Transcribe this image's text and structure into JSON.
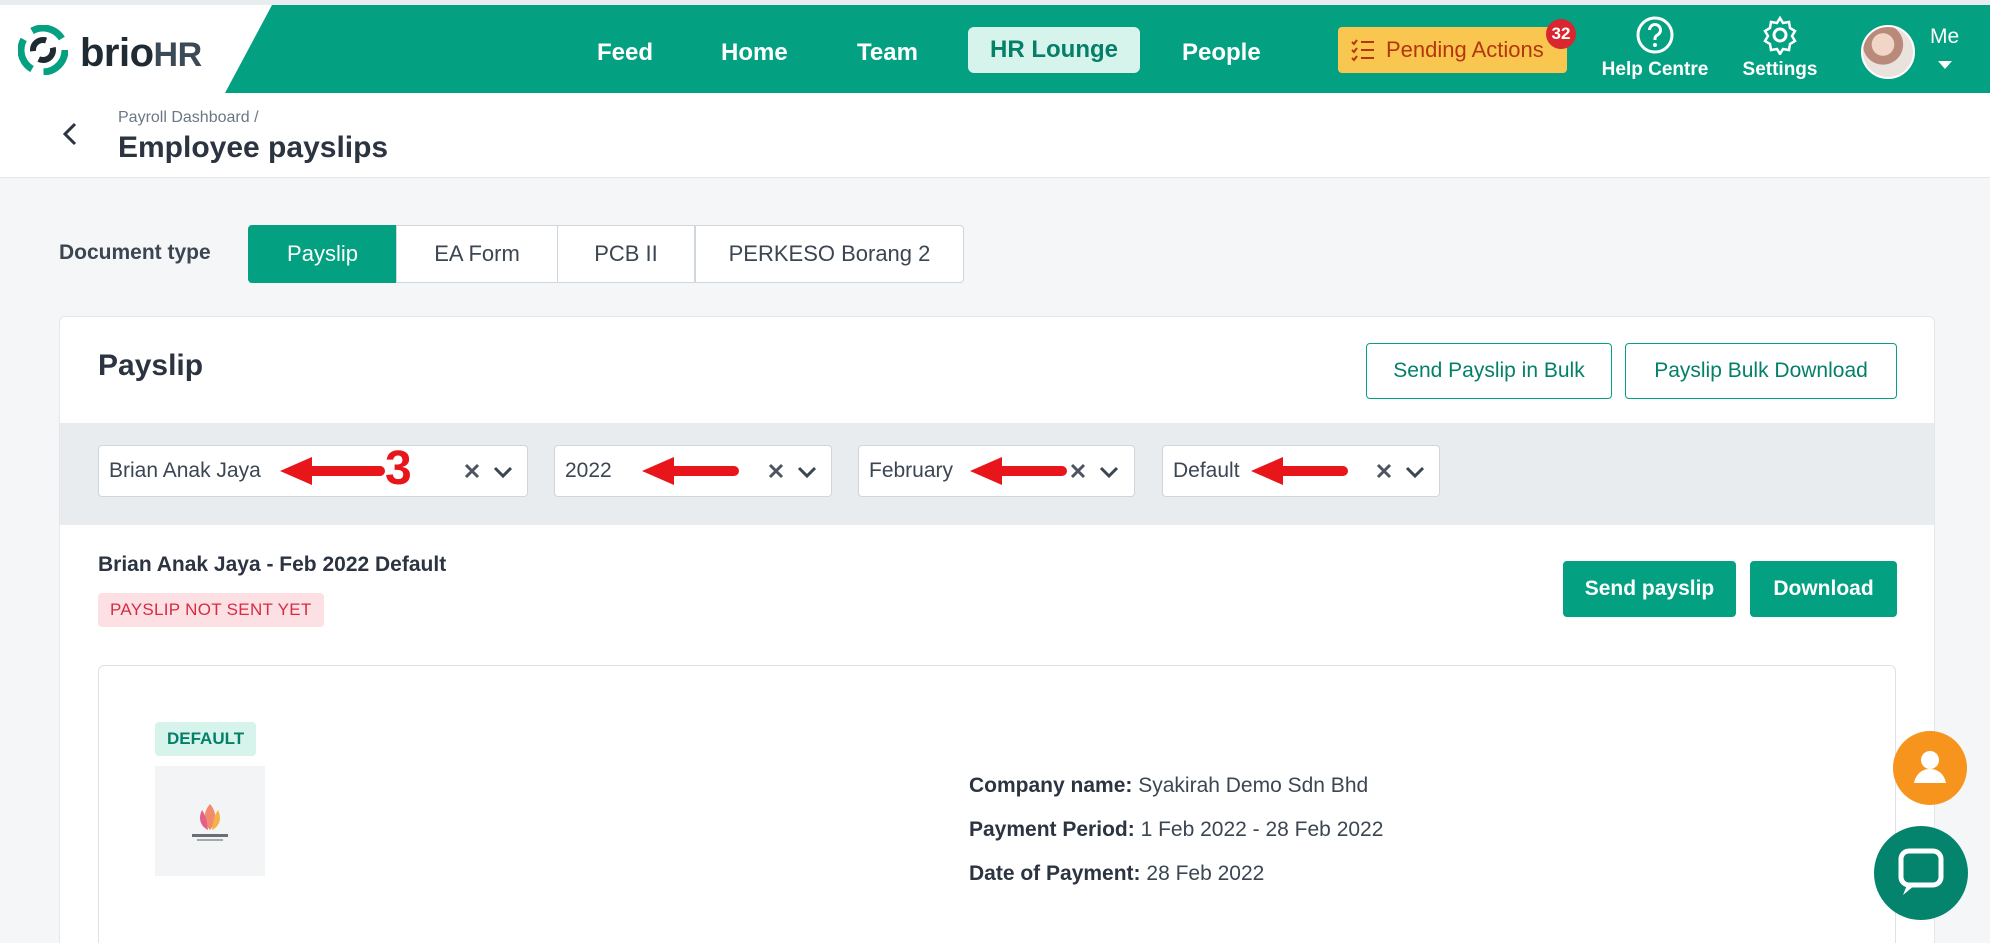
{
  "brand": {
    "name_main": "brio",
    "name_suffix": "HR"
  },
  "nav": {
    "items": [
      "Feed",
      "Home",
      "Team",
      "HR Lounge",
      "People"
    ],
    "active": "HR Lounge"
  },
  "pending": {
    "label": "Pending Actions",
    "count": "32"
  },
  "utilities": {
    "help": "Help Centre",
    "settings": "Settings",
    "me": "Me"
  },
  "header": {
    "breadcrumb": "Payroll Dashboard /",
    "title": "Employee payslips"
  },
  "doc_type": {
    "label": "Document type",
    "options": [
      "Payslip",
      "EA Form",
      "PCB II",
      "PERKESO Borang 2"
    ],
    "selected": "Payslip"
  },
  "card": {
    "title": "Payslip",
    "send_bulk": "Send Payslip in Bulk",
    "bulk_download": "Payslip Bulk Download",
    "filters": {
      "employee": "Brian Anak Jaya",
      "year": "2022",
      "month": "February",
      "template": "Default"
    },
    "annotation": "3",
    "summary": "Brian Anak Jaya - Feb 2022 Default",
    "status": "PAYSLIP NOT SENT YET",
    "send_payslip": "Send payslip",
    "download": "Download",
    "document": {
      "tag": "DEFAULT",
      "company_label": "Company name:",
      "company_value": "Syakirah Demo Sdn Bhd",
      "period_label": "Payment Period:",
      "period_value": "1 Feb 2022 - 28 Feb 2022",
      "payment_label": "Date of Payment:",
      "payment_value": "28 Feb 2022"
    }
  },
  "colors": {
    "brand_green": "#04a082",
    "pending_yellow": "#f9c74f",
    "badge_red": "#d9262f",
    "annotation_red": "#e8151b",
    "fab_orange": "#f7941d"
  }
}
